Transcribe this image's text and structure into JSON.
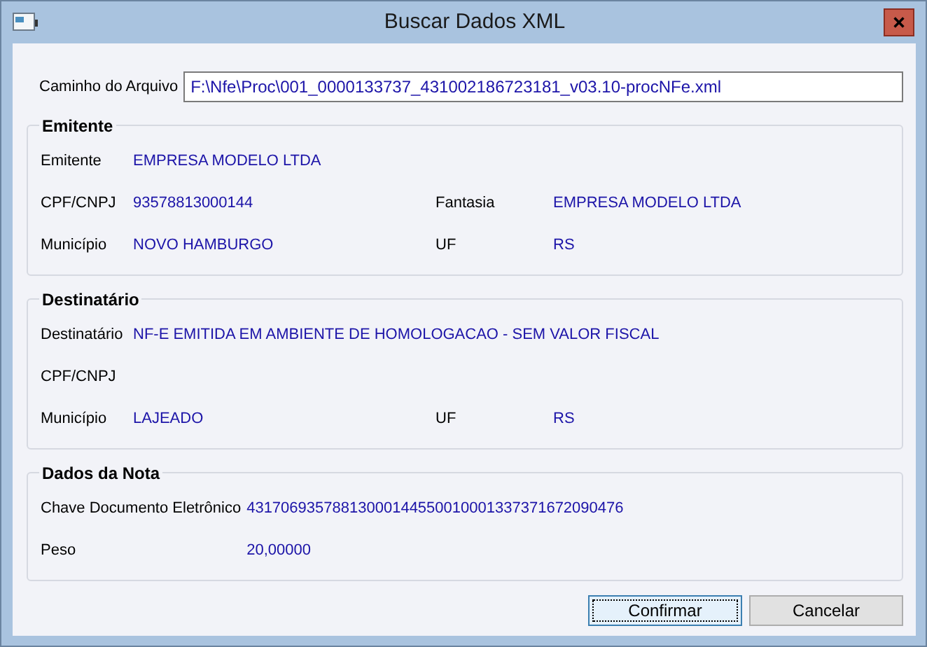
{
  "window": {
    "title": "Buscar Dados XML"
  },
  "file_path": {
    "label": "Caminho do Arquivo",
    "value": "F:\\Nfe\\Proc\\001_0000133737_431002186723181_v03.10-procNFe.xml"
  },
  "groups": [
    {
      "title": "Emitente",
      "rows": [
        [
          {
            "label": "Emitente",
            "value": "EMPRESA MODELO LTDA"
          }
        ],
        [
          {
            "label": "CPF/CNPJ",
            "value": "93578813000144"
          },
          {
            "label": "Fantasia",
            "value": "EMPRESA MODELO LTDA"
          }
        ],
        [
          {
            "label": "Município",
            "value": "NOVO HAMBURGO"
          },
          {
            "label": "UF",
            "value": "RS"
          }
        ]
      ]
    },
    {
      "title": "Destinatário",
      "rows": [
        [
          {
            "label": "Destinatário",
            "value": "NF-E EMITIDA EM AMBIENTE DE HOMOLOGACAO - SEM VALOR FISCAL"
          }
        ],
        [
          {
            "label": "CPF/CNPJ"
          }
        ],
        [
          {
            "label": "Município",
            "value": "LAJEADO"
          },
          {
            "label": "UF",
            "value": "RS"
          }
        ]
      ]
    },
    {
      "title": "Dados da Nota",
      "rows": [
        [
          {
            "label": "Chave Documento Eletrônico",
            "value": "43170693578813000144550010001337371672090476"
          }
        ],
        [
          {
            "label": "Peso",
            "value": "20,00000"
          }
        ]
      ]
    }
  ],
  "buttons": [
    {
      "label": "Confirmar",
      "focused": true
    },
    {
      "label": "Cancelar",
      "focused": false
    }
  ]
}
